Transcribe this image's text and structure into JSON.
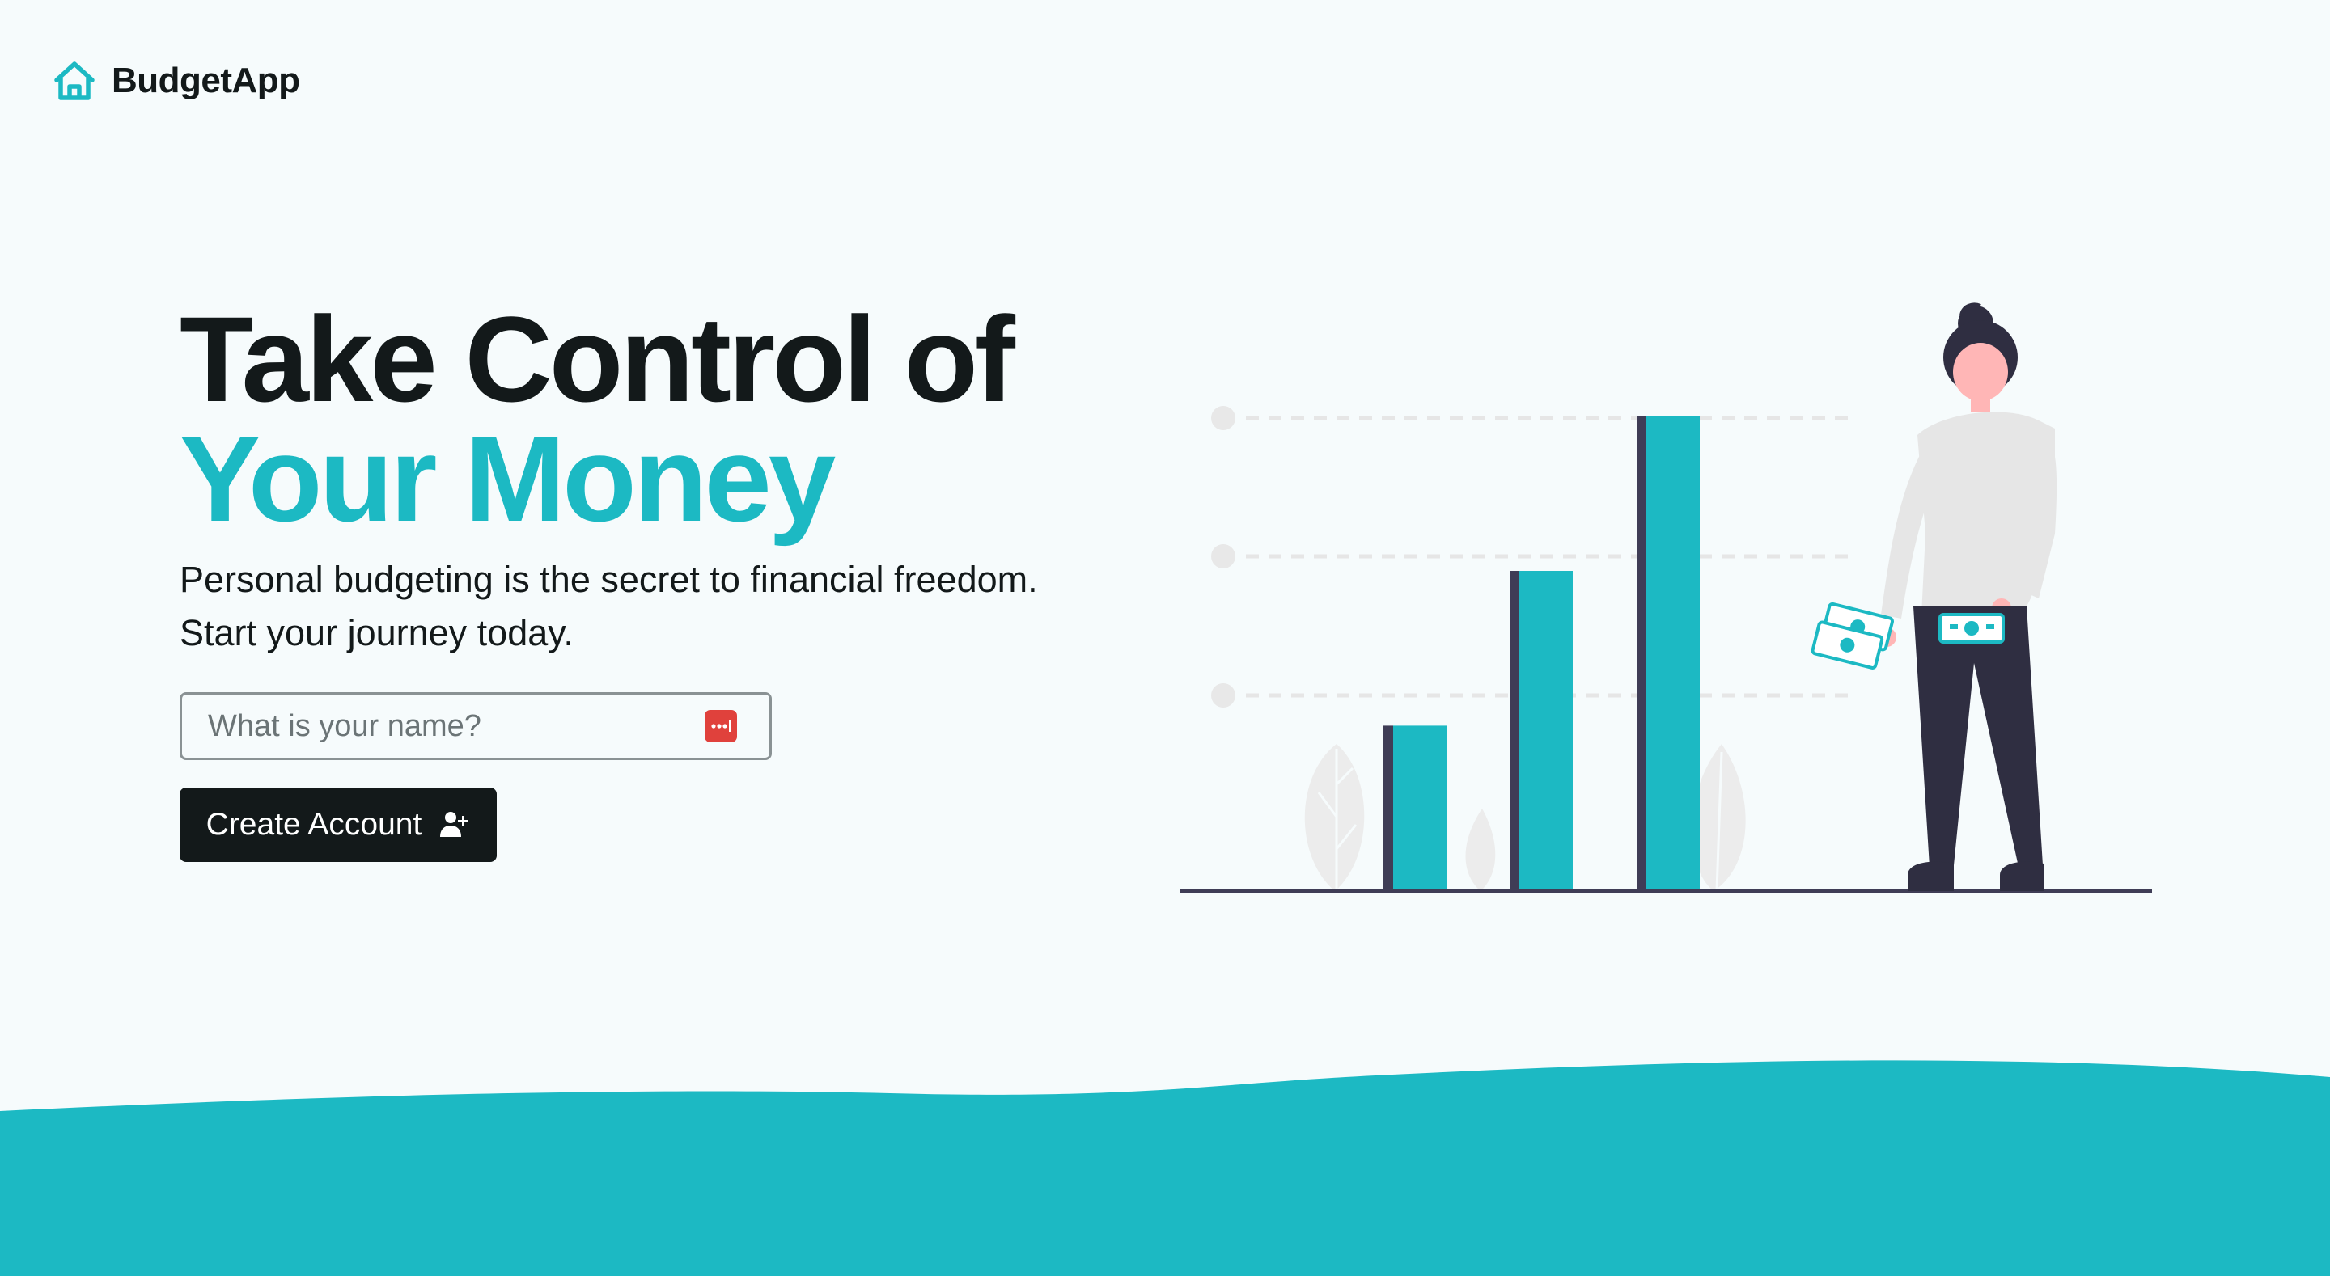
{
  "brand": {
    "name": "BudgetApp",
    "icon": "house-icon"
  },
  "hero": {
    "title_line1": "Take Control of",
    "title_line2": "Your Money",
    "subtitle_line1": "Personal budgeting is the secret to financial freedom.",
    "subtitle_line2": "Start your journey today."
  },
  "form": {
    "name_placeholder": "What is your name?",
    "name_value": "",
    "autofill_icon": "password-manager-icon",
    "submit_label": "Create Account",
    "submit_icon": "user-plus-icon"
  },
  "colors": {
    "accent": "#1cb9c3",
    "dark": "#13191a",
    "background": "#f6fbfc",
    "autofill_icon": "#e0413c"
  },
  "illustration": {
    "icon": "woman-with-bar-chart-illustration",
    "bar_levels": [
      0.31,
      0.6,
      0.89
    ]
  }
}
